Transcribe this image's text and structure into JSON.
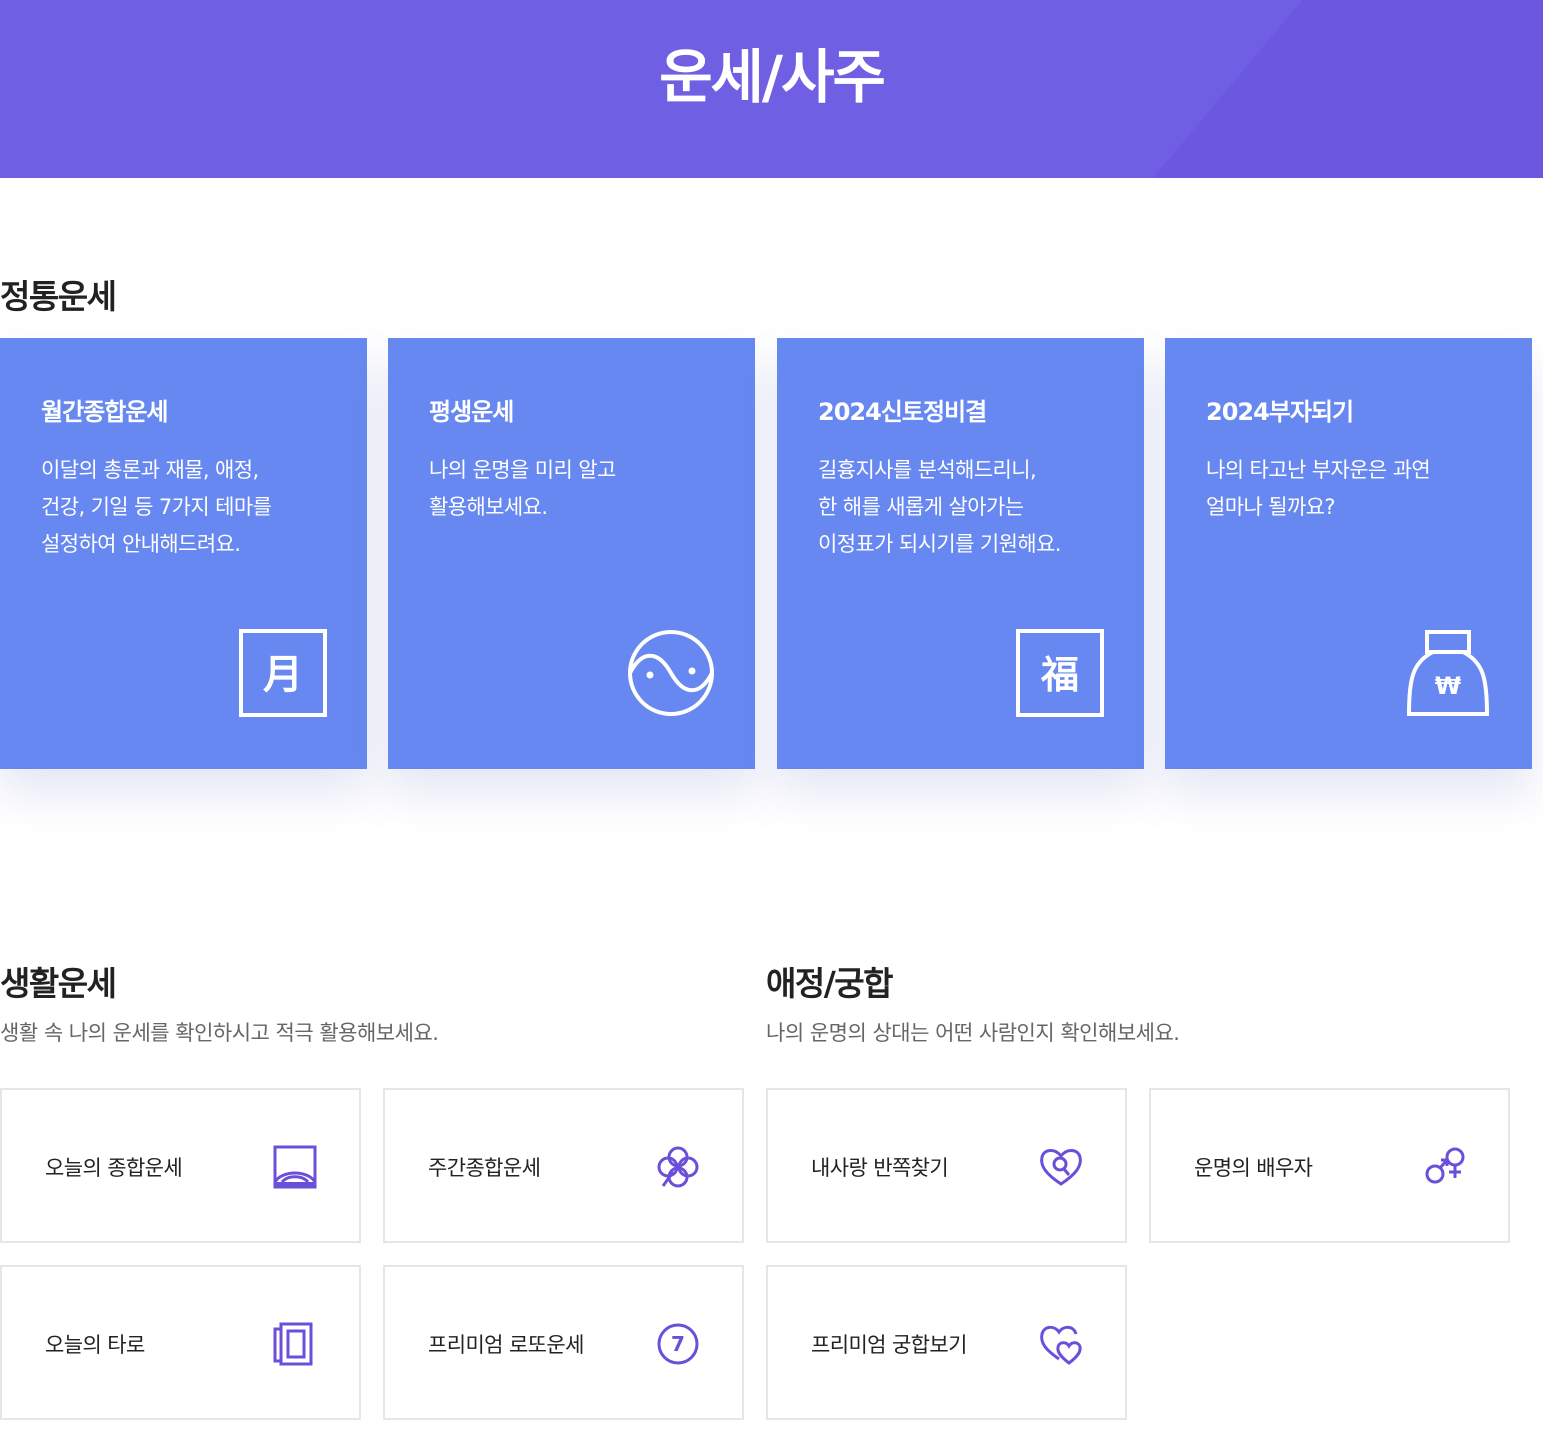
{
  "header": {
    "title": "운세/사주"
  },
  "traditional": {
    "title": "정통운세",
    "cards": [
      {
        "title": "월간종합운세",
        "desc": "이달의 총론과 재물, 애정,\n건강, 기일 등 7가지 테마를\n설정하여 안내해드려요.",
        "icon": "moon-char-icon",
        "icon_text": "月"
      },
      {
        "title": "평생운세",
        "desc": "나의 운명을 미리 알고\n활용해보세요.",
        "icon": "yin-yang-icon"
      },
      {
        "title": "2024신토정비결",
        "desc": "길흉지사를 분석해드리니,\n한 해를 새롭게 살아가는\n이정표가 되시기를 기원해요.",
        "icon": "fortune-char-icon",
        "icon_text": "福"
      },
      {
        "title": "2024부자되기",
        "desc": "나의 타고난 부자운은 과연\n얼마나 될까요?",
        "icon": "money-bag-icon",
        "icon_text": "₩"
      }
    ]
  },
  "life": {
    "title": "생활운세",
    "desc": "생활 속 나의 운세를 확인하시고 적극 활용해보세요.",
    "items": [
      {
        "label": "오늘의 종합운세",
        "icon": "sunrise-icon"
      },
      {
        "label": "주간종합운세",
        "icon": "clover-icon"
      },
      {
        "label": "오늘의 타로",
        "icon": "tarot-cards-icon"
      },
      {
        "label": "프리미엄 로또운세",
        "icon": "lotto-ball-icon",
        "icon_text": "7"
      }
    ]
  },
  "love": {
    "title": "애정/궁합",
    "desc": "나의 운명의 상대는 어떤 사람인지 확인해보세요.",
    "items": [
      {
        "label": "내사랑 반쪽찾기",
        "icon": "heart-search-icon"
      },
      {
        "label": "운명의 배우자",
        "icon": "gender-symbols-icon"
      },
      {
        "label": "프리미엄 궁합보기",
        "icon": "double-heart-icon"
      }
    ]
  },
  "colors": {
    "header_bg": "#6e5fe3",
    "card_bg": "#6688f0",
    "icon_accent": "#6a4fd8"
  }
}
